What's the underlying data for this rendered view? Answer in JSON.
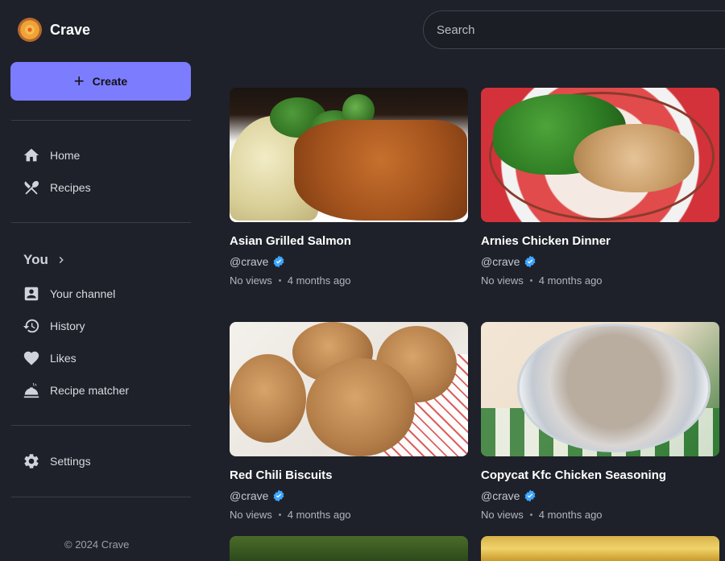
{
  "brand": {
    "name": "Crave"
  },
  "sidebar": {
    "create_label": "Create",
    "main_nav": [
      {
        "label": "Home",
        "icon": "home-icon"
      },
      {
        "label": "Recipes",
        "icon": "utensils-icon"
      }
    ],
    "you_section": {
      "heading": "You",
      "items": [
        {
          "label": "Your channel",
          "icon": "account-box-icon"
        },
        {
          "label": "History",
          "icon": "history-icon"
        },
        {
          "label": "Likes",
          "icon": "heart-icon"
        },
        {
          "label": "Recipe matcher",
          "icon": "dish-icon"
        }
      ]
    },
    "settings": {
      "label": "Settings",
      "icon": "gear-icon"
    },
    "footer": "© 2024 Crave"
  },
  "search": {
    "placeholder": "Search"
  },
  "colors": {
    "background": "#1e2129",
    "accent": "#7c7cff",
    "verified": "#3ea6ff"
  },
  "recipes": [
    {
      "title": "Asian Grilled Salmon",
      "channel": "@crave",
      "views": "No views",
      "age": "4 months ago"
    },
    {
      "title": "Arnies Chicken Dinner",
      "channel": "@crave",
      "views": "No views",
      "age": "4 months ago"
    },
    {
      "title": "Red Chili Biscuits",
      "channel": "@crave",
      "views": "No views",
      "age": "4 months ago"
    },
    {
      "title": "Copycat Kfc Chicken Seasoning",
      "channel": "@crave",
      "views": "No views",
      "age": "4 months ago"
    }
  ]
}
